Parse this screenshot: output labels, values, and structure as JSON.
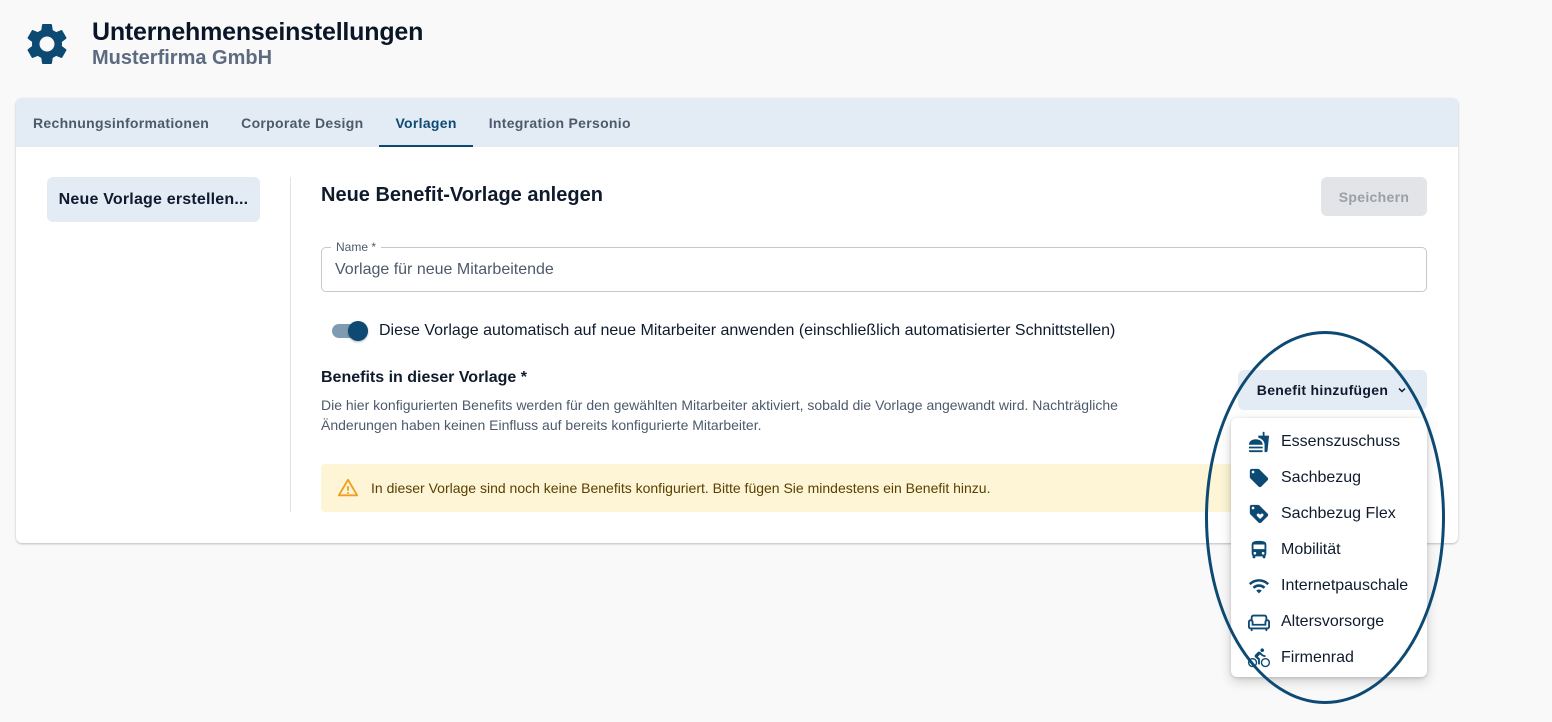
{
  "header": {
    "title": "Unternehmenseinstellungen",
    "subtitle": "Musterfirma GmbH",
    "icon": "gear-icon"
  },
  "tabs": [
    {
      "label": "Rechnungsinformationen",
      "active": false
    },
    {
      "label": "Corporate Design",
      "active": false
    },
    {
      "label": "Vorlagen",
      "active": true
    },
    {
      "label": "Integration Personio",
      "active": false
    }
  ],
  "sidebar": {
    "new_template_label": "Neue Vorlage erstellen..."
  },
  "form": {
    "title": "Neue Benefit-Vorlage anlegen",
    "save_label": "Speichern",
    "name_label": "Name *",
    "name_value": "Vorlage für neue Mitarbeitende",
    "auto_apply_label": "Diese Vorlage automatisch auf neue Mitarbeiter anwenden (einschließlich automatisierter Schnittstellen)",
    "auto_apply_enabled": true,
    "benefits_title": "Benefits in dieser Vorlage *",
    "benefits_description": "Die hier konfigurierten Benefits werden für den gewählten Mitarbeiter aktiviert, sobald die Vorlage angewandt wird. Nachträgliche Änderungen haben keinen Einfluss auf bereits konfigurierte Mitarbeiter.",
    "add_benefit_label": "Benefit hinzufügen",
    "warning_text": "In dieser Vorlage sind noch keine Benefits konfiguriert. Bitte fügen Sie mindestens ein Benefit hinzu."
  },
  "benefit_menu": [
    {
      "label": "Essenszuschuss",
      "icon": "food-icon"
    },
    {
      "label": "Sachbezug",
      "icon": "tag-icon"
    },
    {
      "label": "Sachbezug Flex",
      "icon": "tag-heart-icon"
    },
    {
      "label": "Mobilität",
      "icon": "bus-icon"
    },
    {
      "label": "Internetpauschale",
      "icon": "wifi-icon"
    },
    {
      "label": "Altersvorsorge",
      "icon": "armchair-icon"
    },
    {
      "label": "Firmenrad",
      "icon": "bicycle-icon"
    }
  ],
  "colors": {
    "primary": "#0d4a73",
    "tab_bar": "#e3ecf5",
    "warning_bg": "#fdf5d6",
    "warning_icon": "#f0a020"
  }
}
